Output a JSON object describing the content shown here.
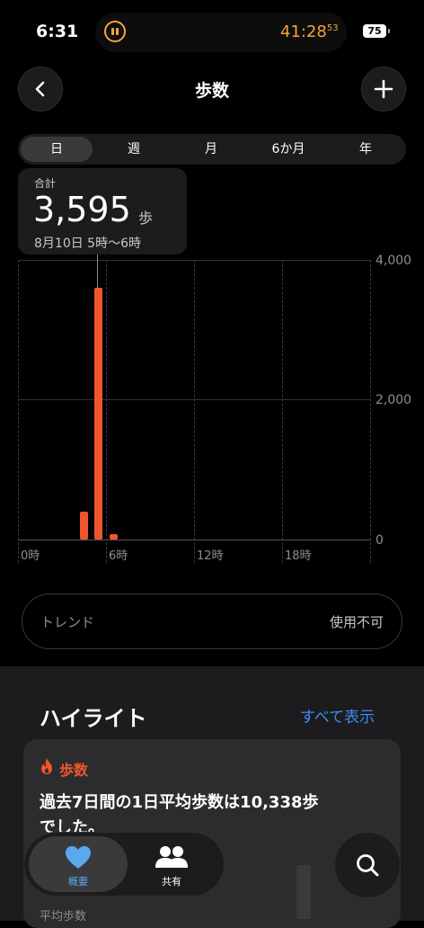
{
  "status_bar": {
    "time": "6:31",
    "timer": "41:28",
    "timer_sub": "53",
    "battery": "75"
  },
  "nav": {
    "title": "歩数"
  },
  "segments": [
    "日",
    "週",
    "月",
    "6か月",
    "年"
  ],
  "summary": {
    "label": "合計",
    "value": "3,595",
    "unit": "歩",
    "range": "8月10日 5時〜6時"
  },
  "chart_data": {
    "type": "bar",
    "y_ticks": [
      "4,000",
      "2,000",
      "0"
    ],
    "x_ticks": [
      "0時",
      "6時",
      "12時",
      "18時"
    ],
    "ylim": [
      0,
      4000
    ],
    "bars": [
      {
        "hour": 4,
        "value": 400
      },
      {
        "hour": 5,
        "value": 3595
      },
      {
        "hour": 6,
        "value": 80
      }
    ],
    "bar_color": "#f0552e",
    "selected_hour": 5
  },
  "trend": {
    "label": "トレンド",
    "status": "使用不可"
  },
  "highlights": {
    "title": "ハイライト",
    "show_all": "すべて表示",
    "card_category": "歩数",
    "card_text_line1": "過去7日間の1日平均歩数は10,338歩",
    "card_text_line2": "でした。",
    "card_footer": "平均歩数"
  },
  "tabs": {
    "summary": "概要",
    "sharing": "共有"
  },
  "colors": {
    "accent": "#f0552e",
    "link": "#3a8eef",
    "timer": "#f7a23b"
  }
}
